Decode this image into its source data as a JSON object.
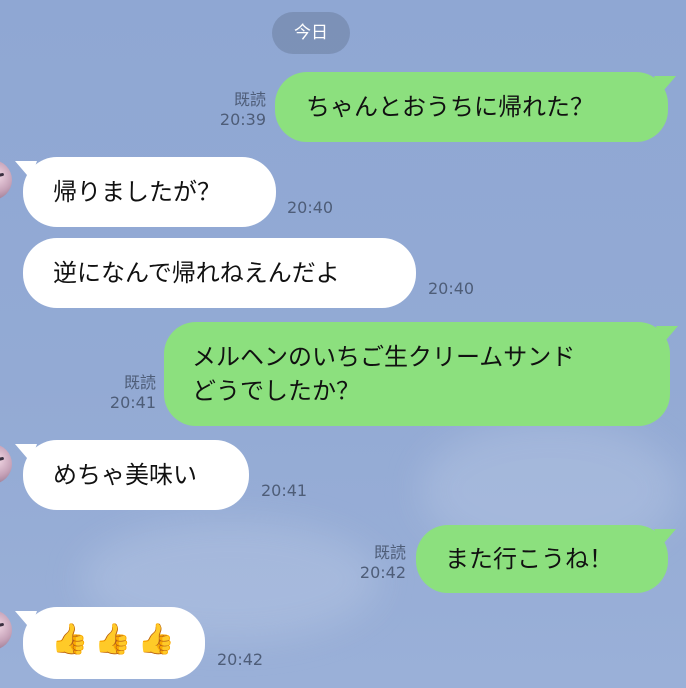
{
  "date_label": "今日",
  "messages": [
    {
      "side": "out",
      "text": "ちゃんとおうちに帰れた？",
      "read": "既読",
      "time": "20:39"
    },
    {
      "side": "in",
      "text": "帰りましたが？",
      "time": "20:40"
    },
    {
      "side": "in",
      "text": "逆になんで帰れねえんだよ",
      "time": "20:40"
    },
    {
      "side": "out",
      "line1": "メルヘンのいちご生クリームサンド",
      "line2": "どうでしたか？",
      "read": "既読",
      "time": "20:41"
    },
    {
      "side": "in",
      "text": "めちゃ美味い",
      "time": "20:41"
    },
    {
      "side": "out",
      "text": "また行こうね！",
      "read": "既読",
      "time": "20:42"
    },
    {
      "side": "in",
      "text": "👍👍👍",
      "time": "20:42"
    }
  ],
  "colors": {
    "background": "#92a9d4",
    "outgoing_bubble": "#8ce07e",
    "incoming_bubble": "#ffffff",
    "meta_text": "#4e5d78"
  },
  "icons": {
    "avatar": "avatar-image",
    "emoji": "thumbs-up"
  }
}
